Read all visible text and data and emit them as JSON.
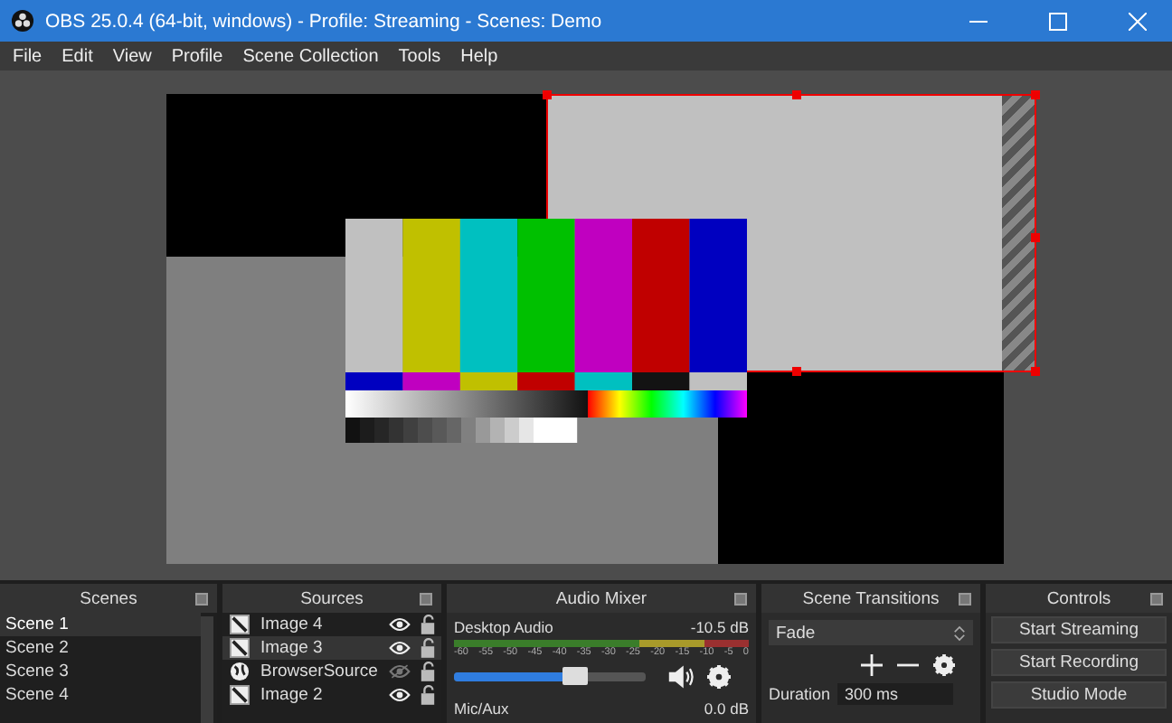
{
  "window": {
    "title": "OBS 25.0.4 (64-bit, windows) - Profile: Streaming - Scenes: Demo"
  },
  "menu": [
    "File",
    "Edit",
    "View",
    "Profile",
    "Scene Collection",
    "Tools",
    "Help"
  ],
  "scenes": {
    "title": "Scenes",
    "items": [
      {
        "name": "Scene 1",
        "selected": true
      },
      {
        "name": "Scene 2",
        "selected": false
      },
      {
        "name": "Scene 3",
        "selected": false
      },
      {
        "name": "Scene 4",
        "selected": false
      }
    ]
  },
  "sources": {
    "title": "Sources",
    "items": [
      {
        "name": "Image 4",
        "kind": "image",
        "visible": true,
        "selected": false
      },
      {
        "name": "Image 3",
        "kind": "image",
        "visible": true,
        "selected": true
      },
      {
        "name": "BrowserSource",
        "kind": "browser",
        "visible": false,
        "selected": false
      },
      {
        "name": "Image 2",
        "kind": "image",
        "visible": true,
        "selected": false
      }
    ]
  },
  "audio_mixer": {
    "title": "Audio Mixer",
    "channels": [
      {
        "name": "Desktop Audio",
        "reading": "-10.5 dB",
        "level": 0.65
      },
      {
        "name": "Mic/Aux",
        "reading": "0.0 dB"
      }
    ],
    "meter_ticks": [
      "-60",
      "-55",
      "-50",
      "-45",
      "-40",
      "-35",
      "-30",
      "-25",
      "-20",
      "-15",
      "-10",
      "-5",
      "0"
    ]
  },
  "scene_transitions": {
    "title": "Scene Transitions",
    "transition": "Fade",
    "duration_label": "Duration",
    "duration": "300 ms"
  },
  "controls": {
    "title": "Controls",
    "buttons": [
      "Start Streaming",
      "Start Recording",
      "Studio Mode"
    ]
  }
}
